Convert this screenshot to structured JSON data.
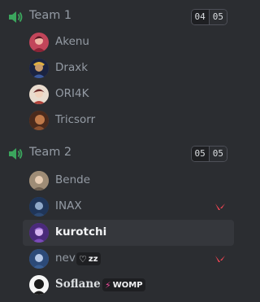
{
  "channels": [
    {
      "name": "Team 1",
      "current": "04",
      "max": "05",
      "members": [
        {
          "name": "Akenu",
          "avatar_color": "#c2455a"
        },
        {
          "name": "Draxk",
          "avatar_color": "#3b4a7a"
        },
        {
          "name": "ORI4K",
          "avatar_color": "#d8c6b6"
        },
        {
          "name": "Tricsorr",
          "avatar_color": "#7a4a32"
        }
      ]
    },
    {
      "name": "Team 2",
      "current": "05",
      "max": "05",
      "members": [
        {
          "name": "Bende",
          "avatar_color": "#b9a58c"
        },
        {
          "name": "INAX",
          "avatar_color": "#35507a",
          "game_icon": "valorant-icon"
        },
        {
          "name": "kurotchi",
          "avatar_color": "#6b3fa0",
          "active": true
        },
        {
          "name": "nev",
          "avatar_color": "#4a6fa5",
          "badge": "zz",
          "badge_icon": "white-heart-icon",
          "game_icon": "valorant-icon"
        },
        {
          "name": "Soflane",
          "avatar_color": "#e8e8e8",
          "badge": "WOMP",
          "badge_icon": "lightning-icon"
        }
      ]
    }
  ],
  "colors": {
    "speaker_green": "#3ba55d",
    "valorant_red": "#ff4655",
    "lightning_pink": "#ec4899"
  }
}
